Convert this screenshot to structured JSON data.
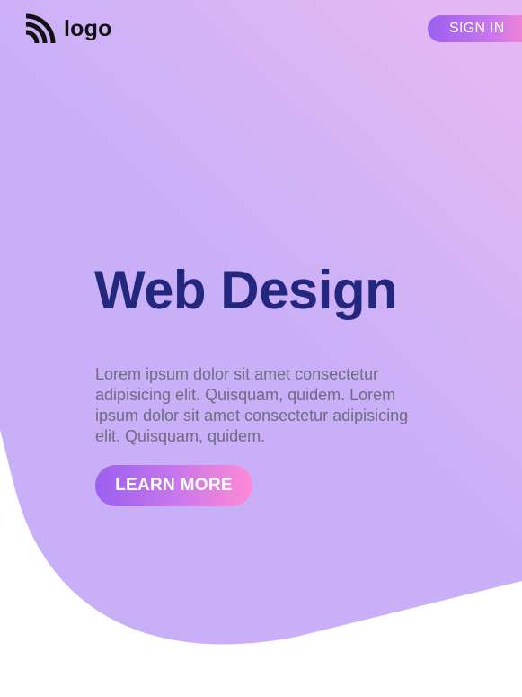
{
  "header": {
    "logo_text": "logo",
    "sign_in_label": "SIGN IN"
  },
  "hero": {
    "title": "Web Design",
    "description": "Lorem ipsum dolor sit amet consectetur adipisicing elit. Quisquam, quidem. Lorem ipsum dolor sit amet consectetur adipisicing elit. Quisquam, quidem.",
    "cta_label": "LEARN MORE"
  },
  "colors": {
    "hero_background_top": "#e3b7f4",
    "hero_background_bottom": "#c9aff8",
    "title_color": "#23287e",
    "text_color": "#6e6c80",
    "button_gradient_start": "#9b5ff0",
    "button_gradient_end": "#ff8ad4"
  },
  "icons": {
    "logo": "signal-waves-icon"
  }
}
